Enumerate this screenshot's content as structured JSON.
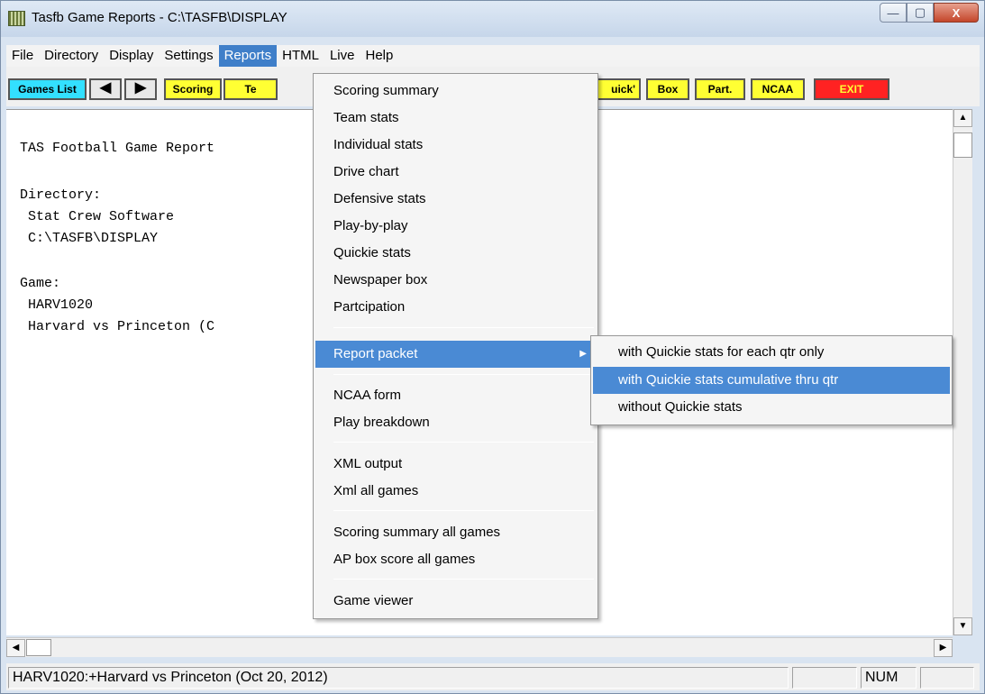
{
  "window": {
    "title": "Tasfb Game Reports - C:\\TASFB\\DISPLAY",
    "min_glyph": "—",
    "max_glyph": "▢",
    "close_glyph": "X"
  },
  "menubar": {
    "items": [
      "File",
      "Directory",
      "Display",
      "Settings",
      "Reports",
      "HTML",
      "Live",
      "Help"
    ],
    "active": "Reports"
  },
  "toolbar": {
    "games_list": "Games List",
    "prev": "◀",
    "next": "▶",
    "scoring": "Scoring",
    "team_partial": "Te",
    "quick_partial": "uick'",
    "box": "Box",
    "part": "Part.",
    "ncaa": "NCAA",
    "exit": "EXIT"
  },
  "content": {
    "lines": [
      "TAS Football Game Report",
      "",
      "Directory:",
      " Stat Crew Software",
      " C:\\TASFB\\DISPLAY",
      "",
      "Game:",
      " HARV1020",
      " Harvard vs Princeton (C"
    ]
  },
  "reports_menu": {
    "items": [
      "Scoring summary",
      "Team stats",
      "Individual stats",
      "Drive chart",
      "Defensive stats",
      "Play-by-play",
      "Quickie stats",
      "Newspaper box",
      "Partcipation",
      "Report packet",
      "NCAA form",
      "Play breakdown",
      "XML output",
      "Xml all games",
      "Scoring summary all games",
      "AP box score all games",
      "Game viewer"
    ],
    "highlighted": "Report packet"
  },
  "report_packet_submenu": {
    "items": [
      "with Quickie stats for each qtr only",
      "with Quickie stats cumulative thru qtr",
      "without Quickie stats"
    ],
    "highlighted": "with Quickie stats cumulative thru qtr"
  },
  "statusbar": {
    "main": "HARV1020:+Harvard vs Princeton (Oct 20, 2012)",
    "num": "NUM"
  },
  "colors": {
    "highlight": "#4a8ad4",
    "button_yellow": "#ffff33",
    "button_cyan": "#33e0ff",
    "exit_red": "#ff2222"
  }
}
